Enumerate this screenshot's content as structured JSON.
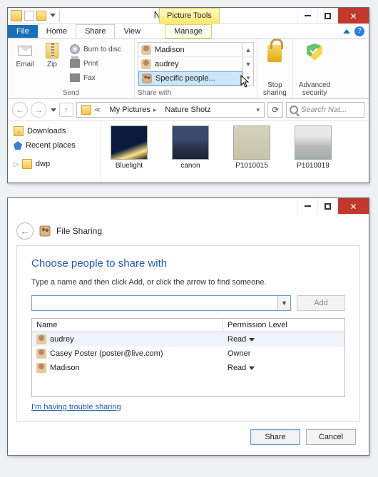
{
  "explorer": {
    "title": "Nature Shotz",
    "tool_tab": "Picture Tools",
    "tabs": {
      "file": "File",
      "home": "Home",
      "share": "Share",
      "view": "View",
      "manage": "Manage"
    },
    "ribbon": {
      "send": {
        "email": "Email",
        "zip": "Zip",
        "burn": "Burn to disc",
        "print": "Print",
        "fax": "Fax",
        "group_label": "Send"
      },
      "sharewith": {
        "users": [
          "Madison",
          "audrey",
          "Specific people..."
        ],
        "group_label": "Share with"
      },
      "stop": "Stop\nsharing",
      "adv": "Advanced\nsecurity"
    },
    "breadcrumb": {
      "a": "My Pictures",
      "b": "Nature Shotz"
    },
    "search_placeholder": "Search Nat...",
    "nav_items": [
      "Downloads",
      "Recent places",
      "dwp"
    ],
    "thumbs": [
      "Bluelight",
      "canon",
      "P1010015",
      "P1010019"
    ]
  },
  "dialog": {
    "title": "File Sharing",
    "heading": "Choose people to share with",
    "hint": "Type a name and then click Add, or click the arrow to find someone.",
    "add_label": "Add",
    "col_name": "Name",
    "col_perm": "Permission Level",
    "rows": [
      {
        "name": "audrey",
        "perm": "Read"
      },
      {
        "name": "Casey Poster (poster@live.com)",
        "perm": "Owner"
      },
      {
        "name": "Madison",
        "perm": "Read"
      }
    ],
    "trouble": "I'm having trouble sharing",
    "share_btn": "Share",
    "cancel_btn": "Cancel"
  }
}
